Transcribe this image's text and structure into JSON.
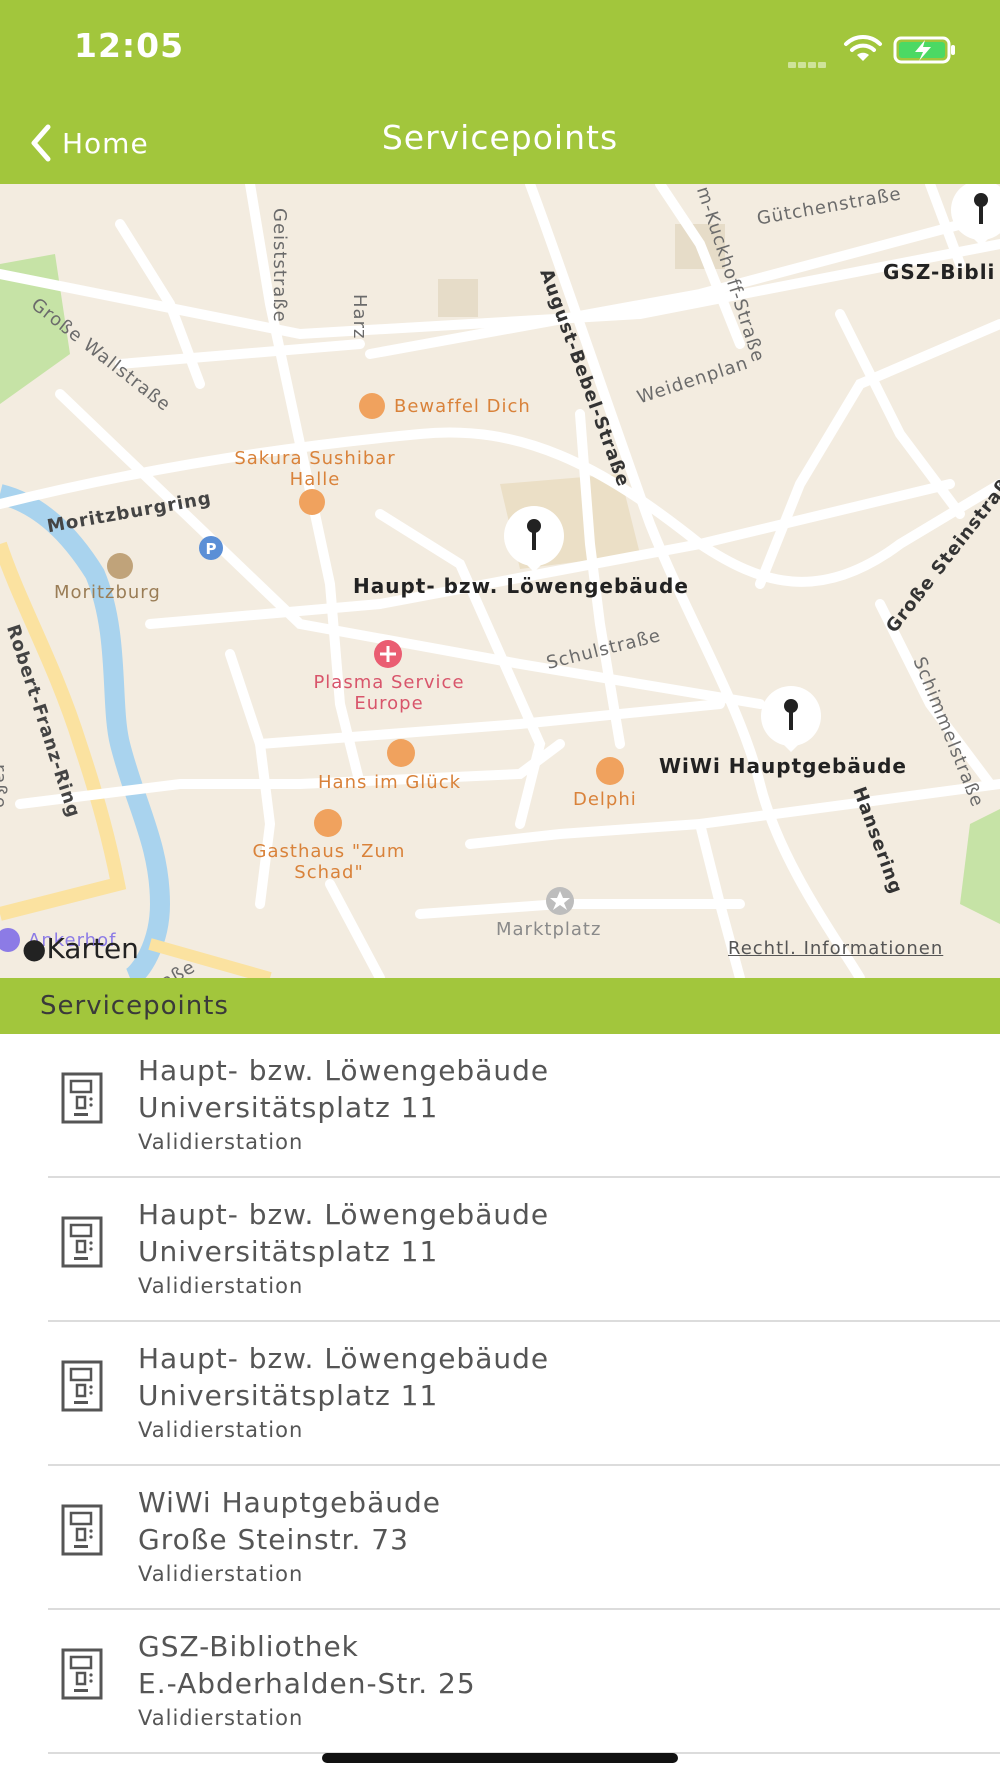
{
  "status_bar": {
    "time": "12:05"
  },
  "nav": {
    "back_label": "Home",
    "title": "Servicepoints"
  },
  "map": {
    "streets": [
      "Gütchenstraße",
      "Geiststraße",
      "Harz",
      "August-Bebel-Straße",
      "m-Kuckhoff-Straße",
      "Große Wallstraße",
      "Weidenplan",
      "Moritzburgring",
      "Robert-Franz-Ring",
      "Schulstraße",
      "Große Steinstraße",
      "Schimmelstraße",
      "Hansering",
      "raße",
      "aße"
    ],
    "pois": [
      {
        "name": "Bewaffel Dich"
      },
      {
        "name": "Sakura Sushibar Halle"
      },
      {
        "name": "Moritzburg"
      },
      {
        "name": "Plasma Service Europe"
      },
      {
        "name": "Hans im Glück"
      },
      {
        "name": "Delphi"
      },
      {
        "name": "Gasthaus \"Zum Schad\""
      },
      {
        "name": "Marktplatz"
      },
      {
        "name": "Ankerhof"
      }
    ],
    "pins": [
      {
        "label": "GSZ-Bibli"
      },
      {
        "label": "Haupt- bzw. Löwengebäude"
      },
      {
        "label": "WiWi Hauptgebäude"
      }
    ],
    "karten_label": "Karten",
    "legal_label": "Rechtl. Informationen",
    "colors": {
      "land": "#f3ece0",
      "road": "#ffffff",
      "water": "#a9d3ee",
      "park": "#c6e3a6",
      "major_road": "#fbe2a0"
    }
  },
  "section_header": "Servicepoints",
  "servicepoints": [
    {
      "name": "Haupt- bzw. Löwengebäude",
      "address": "Universitätsplatz 11",
      "type": "Validierstation"
    },
    {
      "name": "Haupt- bzw. Löwengebäude",
      "address": "Universitätsplatz 11",
      "type": "Validierstation"
    },
    {
      "name": "Haupt- bzw. Löwengebäude",
      "address": "Universitätsplatz 11",
      "type": "Validierstation"
    },
    {
      "name": "WiWi Hauptgebäude",
      "address": "Große Steinstr. 73",
      "type": "Validierstation"
    },
    {
      "name": "GSZ-Bibliothek",
      "address": "E.-Abderhalden-Str. 25",
      "type": "Validierstation"
    }
  ],
  "theme": {
    "accent": "#a2c63c"
  }
}
